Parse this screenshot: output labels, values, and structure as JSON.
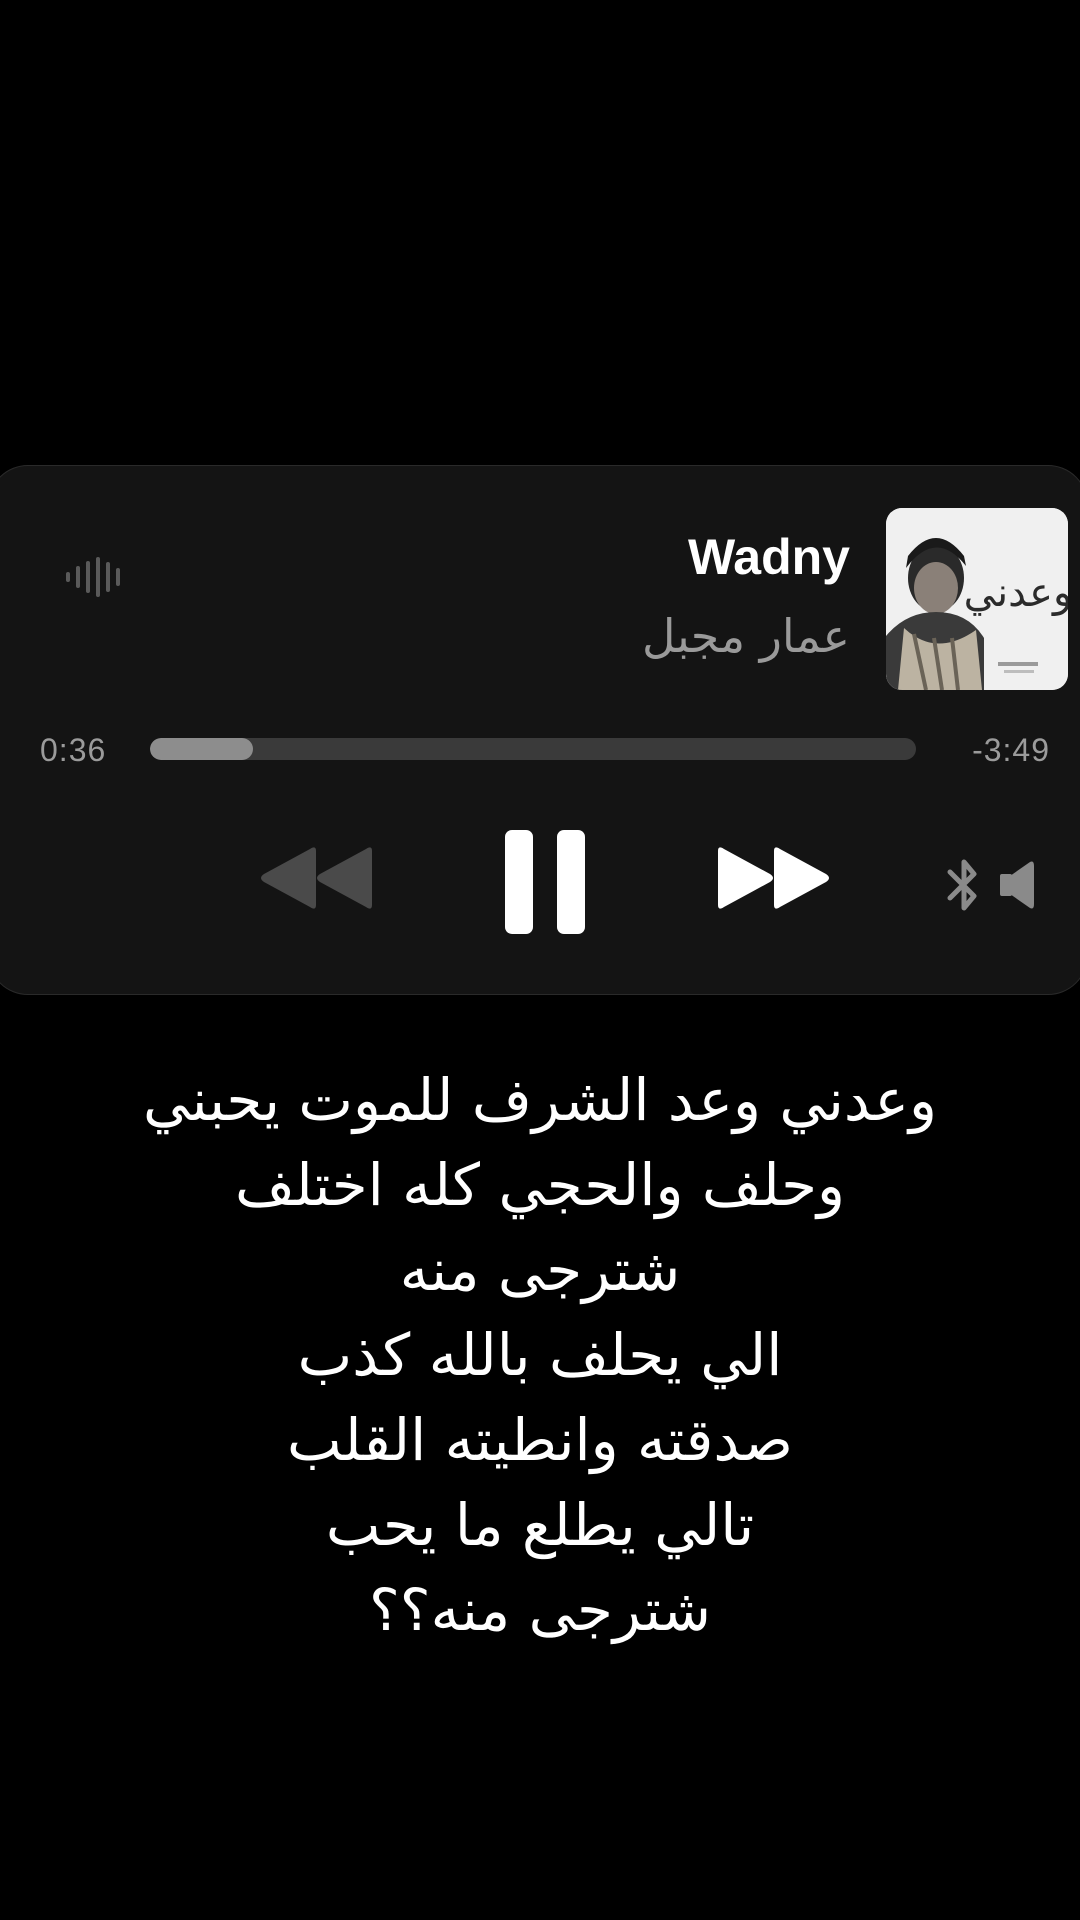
{
  "player": {
    "title": "Wadny",
    "artist": "عمار مجبل",
    "artwork_text": "وعدني",
    "time_elapsed": "0:36",
    "time_remaining": "-3:49",
    "progress": 0.134,
    "icons": {
      "waveform": "waveform-icon",
      "rewind": "rewind-icon",
      "pause": "pause-icon",
      "forward": "fast-forward-icon",
      "output": "bluetooth-speaker-icon"
    },
    "colors": {
      "background": "#000000",
      "card": "#141414",
      "progress_track": "#3a3a3a",
      "progress_fill": "#8d8d8d"
    }
  },
  "lyrics": [
    "وعدني وعد الشرف للموت يحبني",
    "وحلف والحجي كله اختلف",
    "شترجى منه",
    "الي يحلف بالله كذب",
    "صدقته وانطيته القلب",
    "تالي يطلع ما يحب",
    "شترجى منه؟؟"
  ]
}
